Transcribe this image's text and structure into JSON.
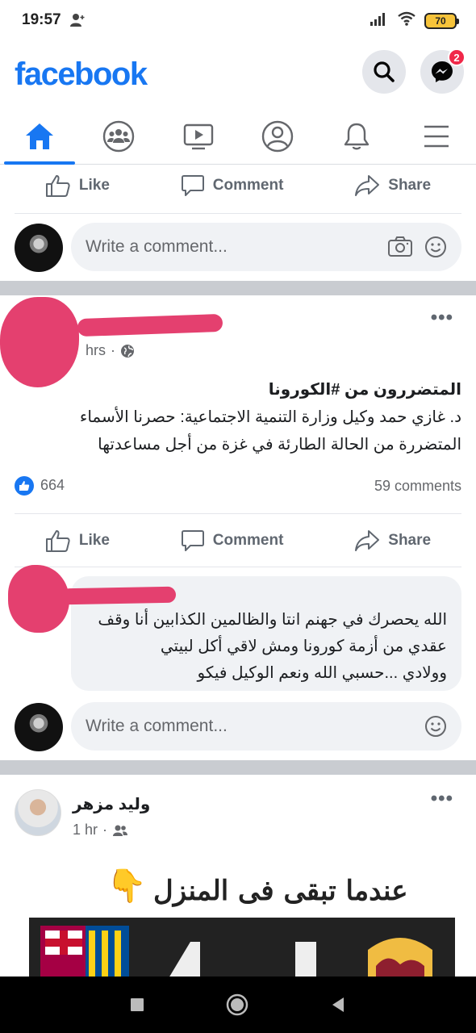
{
  "status_bar": {
    "time": "19:57",
    "battery": "70"
  },
  "header": {
    "logo": "facebook",
    "messenger_badge": "2"
  },
  "nav": {
    "tabs": [
      "home",
      "groups",
      "watch",
      "profile",
      "notifications",
      "menu"
    ],
    "active": "home"
  },
  "actions": {
    "like": "Like",
    "comment": "Comment",
    "share": "Share"
  },
  "composer": {
    "placeholder": "Write a comment..."
  },
  "post1": {
    "time": "hrs",
    "lines": [
      "المتضررون من #الكورونا",
      "د. غازي حمد وكيل وزارة التنمية الاجتماعية: حصرنا الأسماء",
      "المتضررة من الحالة الطارئة  في غزة من أجل مساعدتها"
    ],
    "likes": "664",
    "comments": "59 comments"
  },
  "comment1": {
    "lines": [
      "الله يحصرك في جهنم انتا والظالمين الكذابين أنا وقف",
      "عقدي من أزمة كورونا ومش لاقي أكل لبيتي",
      "وولادي ...حسبي الله ونعم الوكيل فيكو"
    ]
  },
  "post2": {
    "author": "وليد مزهر",
    "time": "1 hr",
    "image_caption": "عندما تبقى فى المنزل",
    "image_emoji": "👇"
  },
  "colors": {
    "brand": "#1877f2",
    "badge": "#f02849",
    "scribble": "#e4406f"
  }
}
